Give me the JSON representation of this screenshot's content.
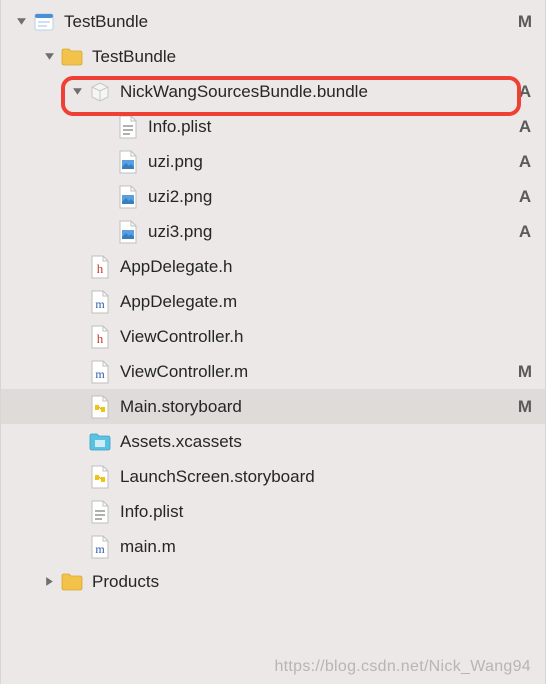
{
  "statuses": {
    "M": "M",
    "A": "A"
  },
  "watermark": "https://blog.csdn.net/Nick_Wang94",
  "tree": {
    "root": {
      "label": "TestBundle",
      "status": "M",
      "expanded": true,
      "iconType": "xcodeproj",
      "children": [
        {
          "label": "TestBundle",
          "expanded": true,
          "iconType": "folder",
          "children": [
            {
              "label": "NickWangSourcesBundle.bundle",
              "status": "A",
              "expanded": true,
              "highlighted": true,
              "iconType": "bundle",
              "children": [
                {
                  "label": "Info.plist",
                  "status": "A",
                  "iconType": "plist"
                },
                {
                  "label": "uzi.png",
                  "status": "A",
                  "iconType": "png"
                },
                {
                  "label": "uzi2.png",
                  "status": "A",
                  "iconType": "png"
                },
                {
                  "label": "uzi3.png",
                  "status": "A",
                  "iconType": "png"
                }
              ]
            },
            {
              "label": "AppDelegate.h",
              "iconType": "h"
            },
            {
              "label": "AppDelegate.m",
              "iconType": "m"
            },
            {
              "label": "ViewController.h",
              "iconType": "h"
            },
            {
              "label": "ViewController.m",
              "status": "M",
              "iconType": "m"
            },
            {
              "label": "Main.storyboard",
              "status": "M",
              "selected": true,
              "iconType": "storyboard"
            },
            {
              "label": "Assets.xcassets",
              "iconType": "xcassets"
            },
            {
              "label": "LaunchScreen.storyboard",
              "iconType": "storyboard"
            },
            {
              "label": "Info.plist",
              "iconType": "plist"
            },
            {
              "label": "main.m",
              "iconType": "m"
            }
          ]
        },
        {
          "label": "Products",
          "expanded": false,
          "iconType": "folder"
        }
      ]
    }
  }
}
